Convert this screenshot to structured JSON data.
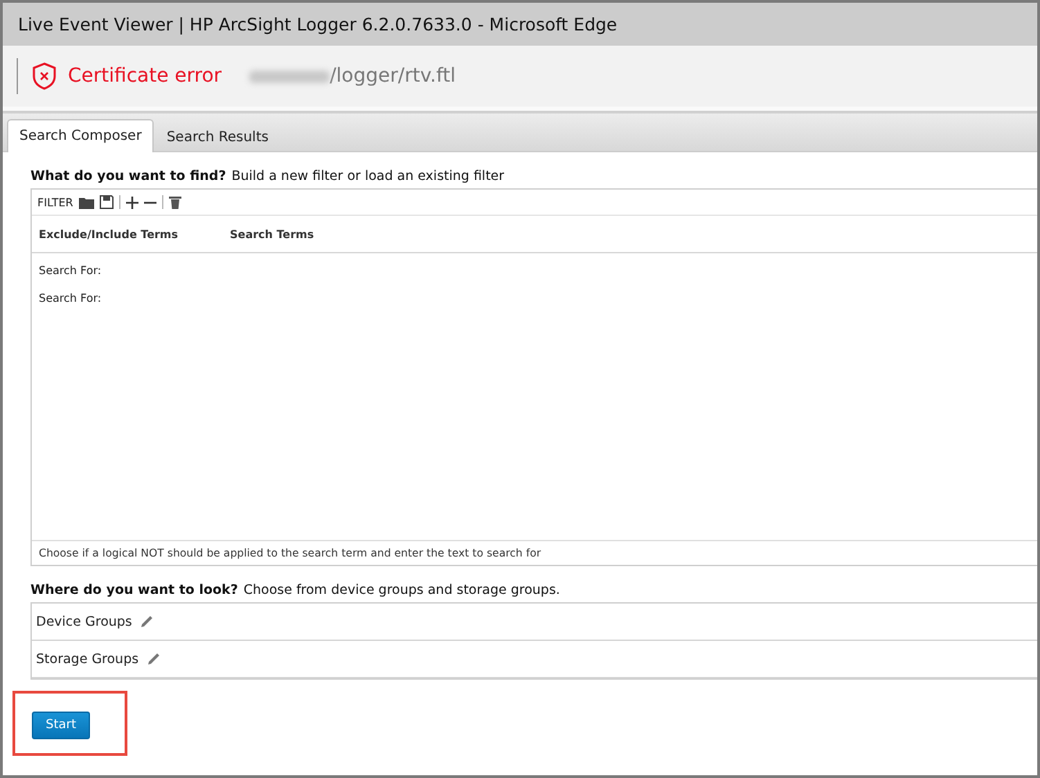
{
  "window": {
    "title": "Live Event Viewer | HP ArcSight Logger 6.2.0.7633.0 - Microsoft Edge"
  },
  "address_bar": {
    "security": "Certificate error",
    "path": "/logger/rtv.ftl"
  },
  "tabs": [
    {
      "label": "Search Composer",
      "selected": true
    },
    {
      "label": "Search Results",
      "selected": false
    }
  ],
  "find": {
    "heading": "What do you want to find?",
    "hint": "Build a new filter or load an existing filter",
    "toolbar_label": "FILTER",
    "columns": [
      "Exclude/Include Terms",
      "Search Terms"
    ],
    "rows": [
      "Search For:",
      "Search For:"
    ],
    "footer": "Choose if a logical NOT should be applied to the search term and enter the text to search for"
  },
  "look": {
    "heading": "Where do you want to look?",
    "hint": "Choose from device groups and storage groups.",
    "groups": [
      "Device Groups",
      "Storage Groups"
    ]
  },
  "start_button": {
    "label": "Start",
    "highlighted": true
  }
}
